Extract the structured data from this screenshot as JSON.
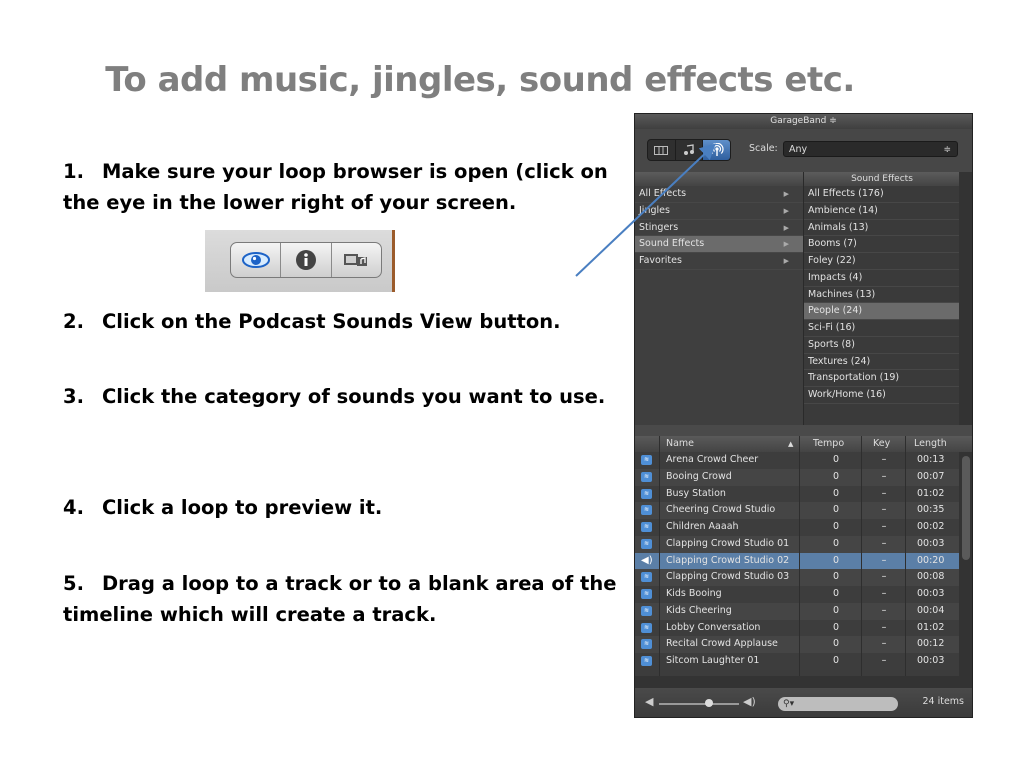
{
  "slide": {
    "title": "To add music, jingles, sound effects etc.",
    "steps": [
      {
        "num": "1.",
        "text": "Make sure your loop browser is open (click on the eye in the lower right of your screen."
      },
      {
        "num": "2.",
        "text": "Click on the Podcast Sounds View button."
      },
      {
        "num": "3.",
        "text": "Click the category of sounds you want to use."
      },
      {
        "num": "4.",
        "text": "Click a loop to preview it."
      },
      {
        "num": "5.",
        "text": "Drag a loop to a track or to a blank area of the timeline which will create a track."
      }
    ]
  },
  "toolbar_icons": [
    "eye-icon",
    "info-icon",
    "media-browser-icon"
  ],
  "garageband": {
    "title": "GarageBand ≑",
    "view_buttons": [
      "column-view-icon",
      "musical-loops-icon",
      "podcast-sounds-icon"
    ],
    "scale_label": "Scale:",
    "scale_value": "Any",
    "right_header": "Sound Effects",
    "categories": [
      {
        "label": "All Effects"
      },
      {
        "label": "Jingles"
      },
      {
        "label": "Stingers"
      },
      {
        "label": "Sound Effects",
        "selected": true
      },
      {
        "label": "Favorites"
      }
    ],
    "subcategories": [
      {
        "label": "All Effects (176)"
      },
      {
        "label": "Ambience (14)"
      },
      {
        "label": "Animals (13)"
      },
      {
        "label": "Booms (7)"
      },
      {
        "label": "Foley (22)"
      },
      {
        "label": "Impacts (4)"
      },
      {
        "label": "Machines (13)"
      },
      {
        "label": "People (24)",
        "selected": true
      },
      {
        "label": "Sci-Fi (16)"
      },
      {
        "label": "Sports (8)"
      },
      {
        "label": "Textures (24)"
      },
      {
        "label": "Transportation (19)"
      },
      {
        "label": "Work/Home (16)"
      }
    ],
    "columns": {
      "name": "Name",
      "tempo": "Tempo",
      "key": "Key",
      "length": "Length"
    },
    "loops": [
      {
        "name": "Arena Crowd Cheer",
        "tempo": "0",
        "key": "–",
        "length": "00:13"
      },
      {
        "name": "Booing Crowd",
        "tempo": "0",
        "key": "–",
        "length": "00:07"
      },
      {
        "name": "Busy Station",
        "tempo": "0",
        "key": "–",
        "length": "01:02"
      },
      {
        "name": "Cheering Crowd Studio",
        "tempo": "0",
        "key": "–",
        "length": "00:35"
      },
      {
        "name": "Children Aaaah",
        "tempo": "0",
        "key": "–",
        "length": "00:02"
      },
      {
        "name": "Clapping Crowd Studio 01",
        "tempo": "0",
        "key": "–",
        "length": "00:03"
      },
      {
        "name": "Clapping Crowd Studio 02",
        "tempo": "0",
        "key": "–",
        "length": "00:20",
        "selected": true
      },
      {
        "name": "Clapping Crowd Studio 03",
        "tempo": "0",
        "key": "–",
        "length": "00:08"
      },
      {
        "name": "Kids Booing",
        "tempo": "0",
        "key": "–",
        "length": "00:03"
      },
      {
        "name": "Kids Cheering",
        "tempo": "0",
        "key": "–",
        "length": "00:04"
      },
      {
        "name": "Lobby Conversation",
        "tempo": "0",
        "key": "–",
        "length": "01:02"
      },
      {
        "name": "Recital Crowd Applause",
        "tempo": "0",
        "key": "–",
        "length": "00:12"
      },
      {
        "name": "Sitcom Laughter 01",
        "tempo": "0",
        "key": "–",
        "length": "00:03"
      }
    ],
    "item_count": "24 items",
    "colors": {
      "selection": "#5b7fa7",
      "accent": "#2f5f9f",
      "arrow": "#4a7fc1"
    }
  }
}
